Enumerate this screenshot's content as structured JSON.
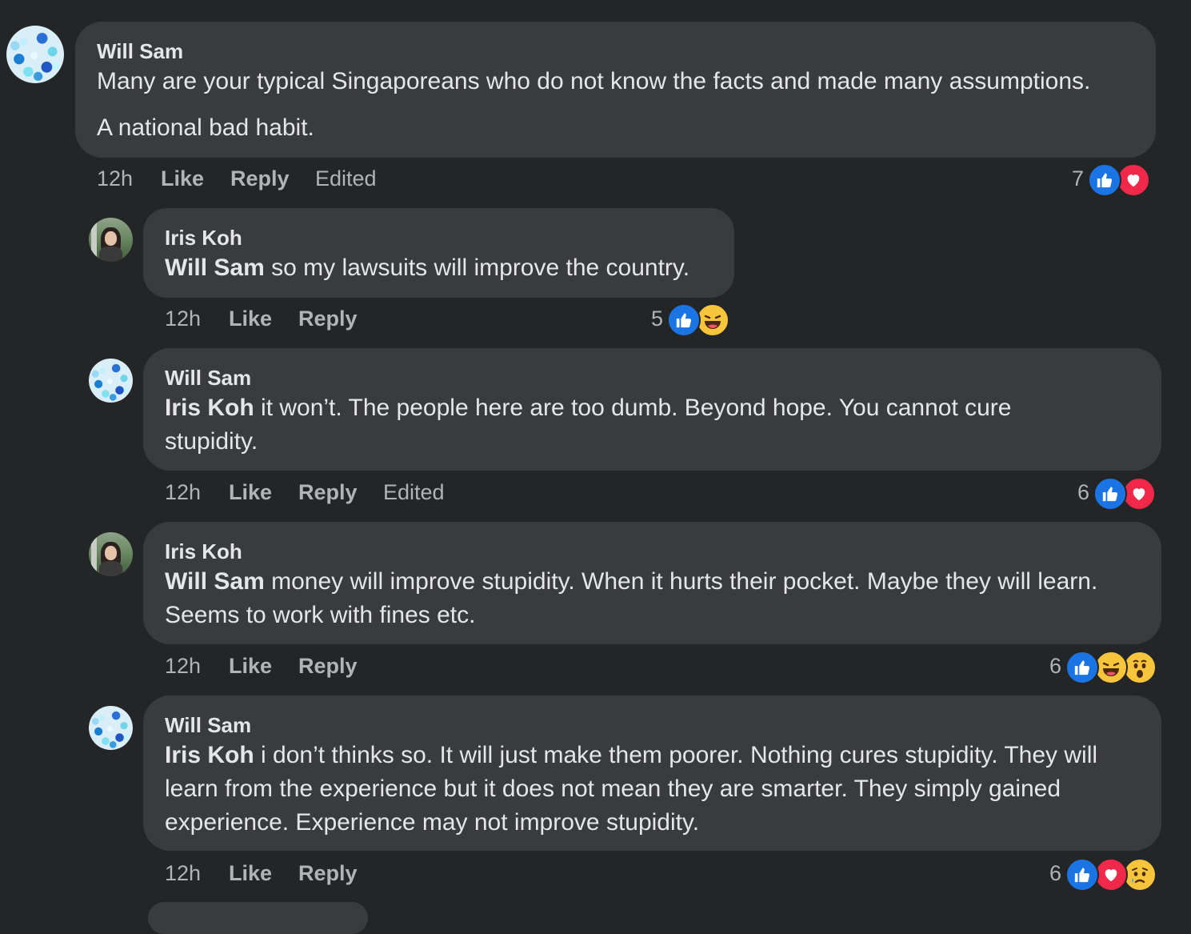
{
  "comments": [
    {
      "author": "Will Sam",
      "mention": "",
      "paragraphs": [
        "Many are your typical Singaporeans who do not know the facts and made many assumptions.",
        "A national bad habit."
      ],
      "time": "12h",
      "like_label": "Like",
      "reply_label": "Reply",
      "edited_label": "Edited",
      "reaction_count": "7",
      "reactions": [
        "like-icon",
        "love-icon"
      ]
    },
    {
      "author": "Iris Koh",
      "mention": "Will Sam",
      "text": " so my lawsuits will improve the country.",
      "time": "12h",
      "like_label": "Like",
      "reply_label": "Reply",
      "reaction_count": "5",
      "reactions": [
        "like-icon",
        "haha-icon"
      ]
    },
    {
      "author": "Will Sam",
      "mention": "Iris Koh",
      "text": " it won’t. The people here are too dumb. Beyond hope. You cannot cure stupidity.",
      "time": "12h",
      "like_label": "Like",
      "reply_label": "Reply",
      "edited_label": "Edited",
      "reaction_count": "6",
      "reactions": [
        "like-icon",
        "love-icon"
      ]
    },
    {
      "author": "Iris Koh",
      "mention": "Will Sam",
      "text": " money will improve stupidity. When it hurts their pocket. Maybe they will learn. Seems to work with fines etc.",
      "time": "12h",
      "like_label": "Like",
      "reply_label": "Reply",
      "reaction_count": "6",
      "reactions": [
        "like-icon",
        "haha-icon",
        "wow-icon"
      ]
    },
    {
      "author": "Will Sam",
      "mention": "Iris Koh",
      "text": " i don’t thinks so. It will just make them poorer. Nothing cures stupidity. They will learn from the experience but it does not mean they are smarter. They simply gained experience. Experience may not improve stupidity.",
      "time": "12h",
      "like_label": "Like",
      "reply_label": "Reply",
      "reaction_count": "6",
      "reactions": [
        "like-icon",
        "love-icon",
        "sad-icon"
      ]
    }
  ],
  "colors": {
    "background": "#242526",
    "bubble": "#3a3b3c",
    "primary_text": "#e4e6eb",
    "secondary_text": "#b0b3b8",
    "like_blue": "#1b74e4",
    "love_red": "#f0284a",
    "emoji_yellow": "#f7c53c"
  }
}
